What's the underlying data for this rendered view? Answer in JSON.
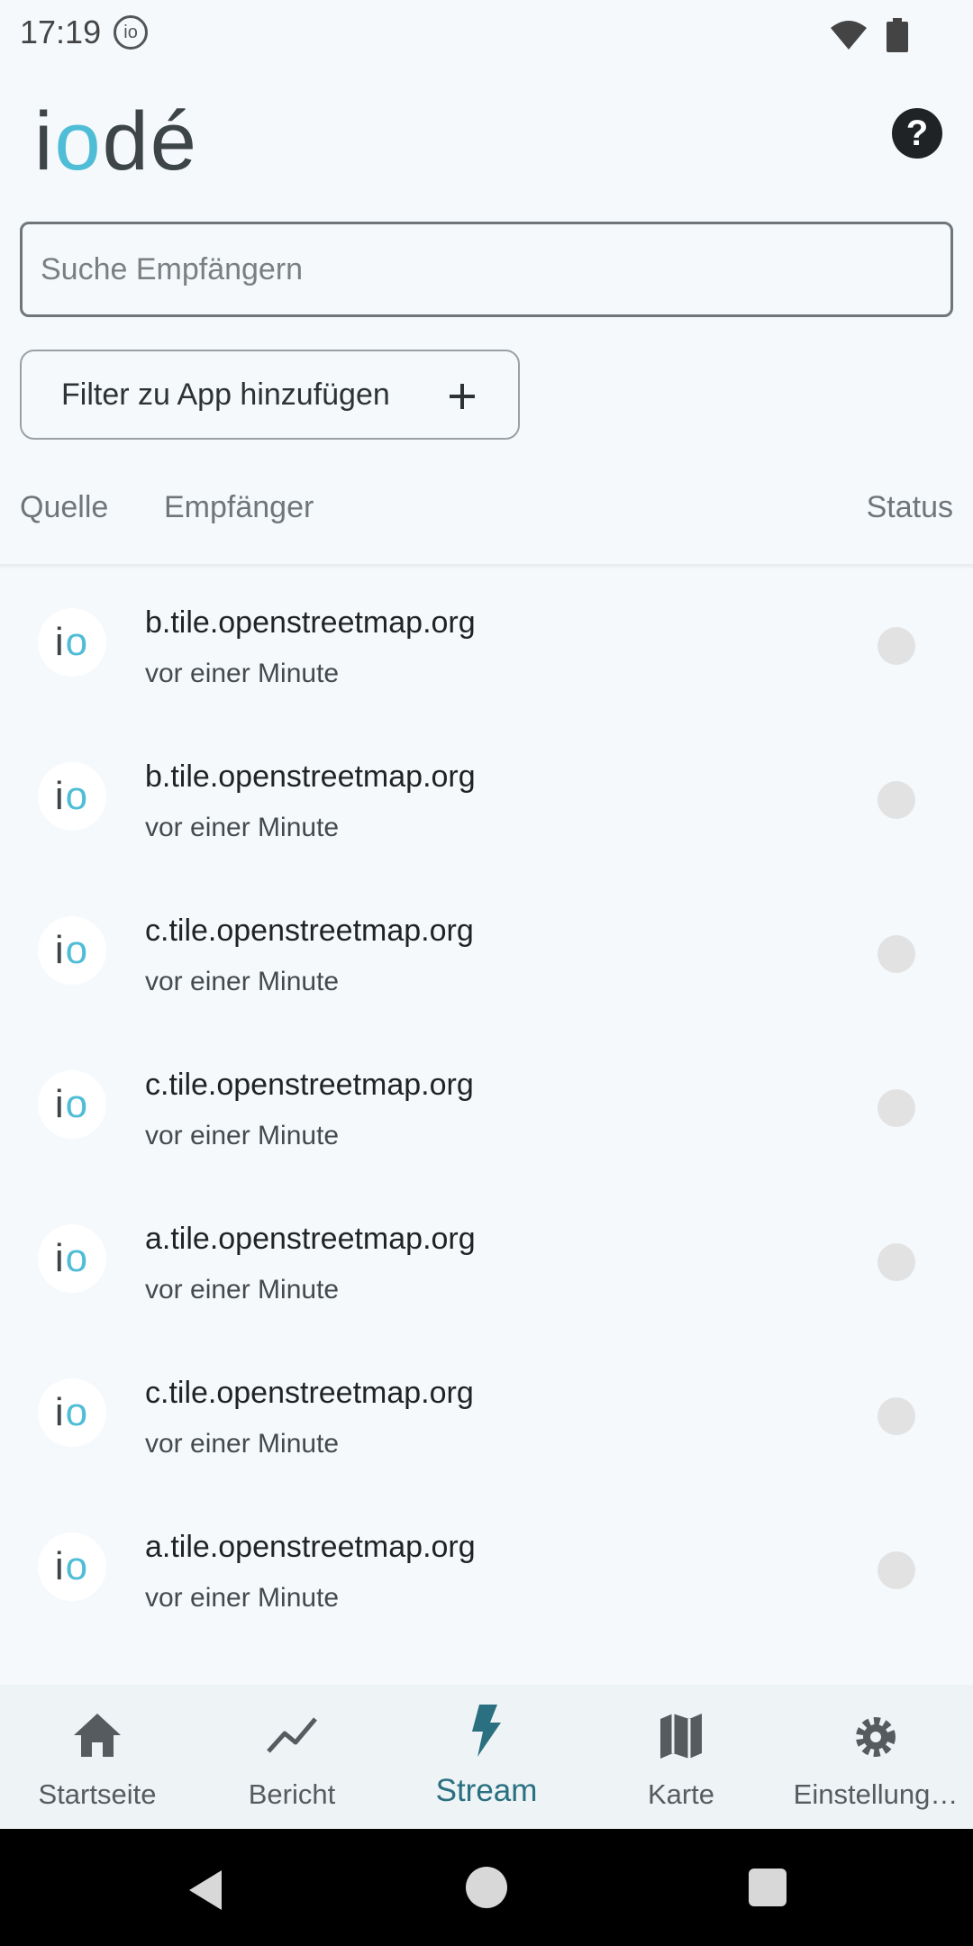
{
  "status_bar": {
    "time": "17:19",
    "io_badge": "io",
    "icons": [
      "wifi-icon",
      "battery-icon"
    ]
  },
  "header": {
    "logo_i": "i",
    "logo_o": "o",
    "logo_rest": "dé",
    "help_label": "?"
  },
  "search": {
    "placeholder": "Suche Empfängern"
  },
  "filter": {
    "label": "Filter zu App hinzufügen",
    "plus": "+"
  },
  "columns": {
    "source": "Quelle",
    "recipient": "Empfänger",
    "status": "Status"
  },
  "rows": [
    {
      "host": "b.tile.openstreetmap.org",
      "time": "vor einer Minute",
      "avatar_i": "i",
      "avatar_o": "o"
    },
    {
      "host": "b.tile.openstreetmap.org",
      "time": "vor einer Minute",
      "avatar_i": "i",
      "avatar_o": "o"
    },
    {
      "host": "c.tile.openstreetmap.org",
      "time": "vor einer Minute",
      "avatar_i": "i",
      "avatar_o": "o"
    },
    {
      "host": "c.tile.openstreetmap.org",
      "time": "vor einer Minute",
      "avatar_i": "i",
      "avatar_o": "o"
    },
    {
      "host": "a.tile.openstreetmap.org",
      "time": "vor einer Minute",
      "avatar_i": "i",
      "avatar_o": "o"
    },
    {
      "host": "c.tile.openstreetmap.org",
      "time": "vor einer Minute",
      "avatar_i": "i",
      "avatar_o": "o"
    },
    {
      "host": "a.tile.openstreetmap.org",
      "time": "vor einer Minute",
      "avatar_i": "i",
      "avatar_o": "o"
    }
  ],
  "nav": [
    {
      "label": "Startseite",
      "icon": "home-icon"
    },
    {
      "label": "Bericht",
      "icon": "trend-icon"
    },
    {
      "label": "Stream",
      "icon": "bolt-icon",
      "active": true
    },
    {
      "label": "Karte",
      "icon": "map-icon"
    },
    {
      "label": "Einstellung…",
      "icon": "gear-icon"
    }
  ],
  "colors": {
    "accent": "#2a7080",
    "logo_o": "#4fbdd6",
    "background": "#f5f9fc"
  }
}
